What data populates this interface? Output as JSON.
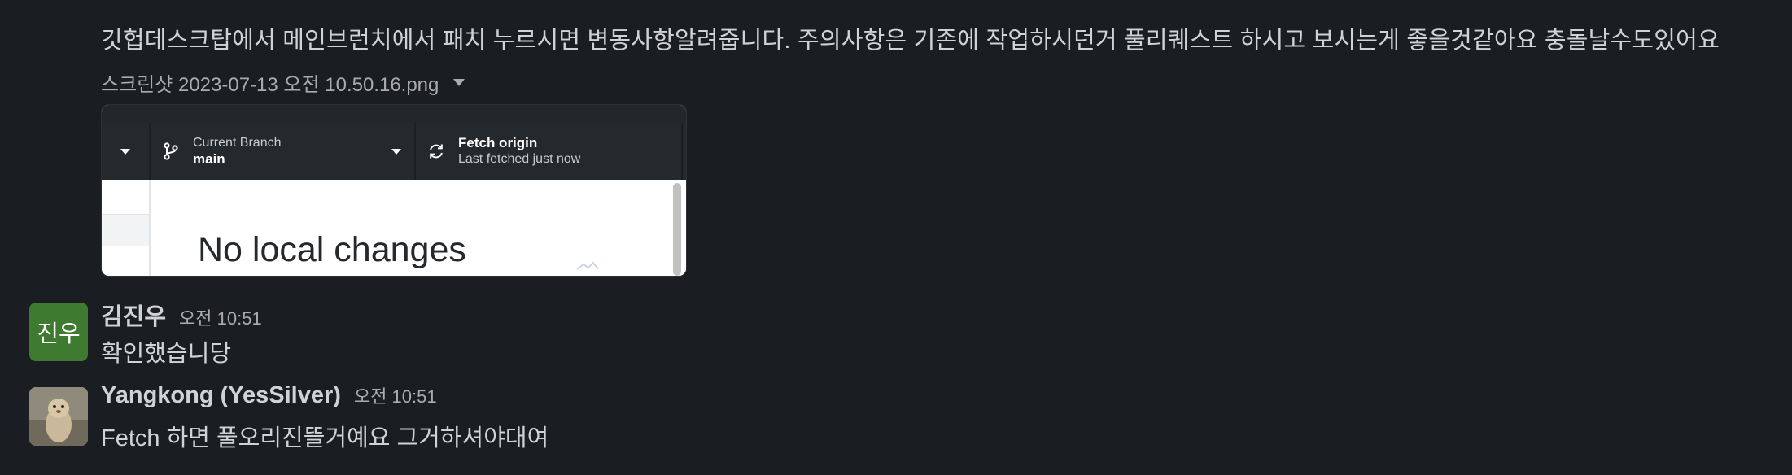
{
  "thread": {
    "prev_message": {
      "text": "깃헙데스크탑에서 메인브런치에서 패치 누르시면 변동사항알려줍니다. 주의사항은 기존에 작업하시던거 풀리퀘스트 하시고 보시는게 좋을것같아요 충돌날수도있어요",
      "file_name": "스크린샷 2023-07-13 오전 10.50.16.png",
      "attachment": {
        "current_branch_label": "Current Branch",
        "current_branch_value": "main",
        "fetch_label": "Fetch origin",
        "fetch_sub": "Last fetched just now",
        "empty_state": "No local changes"
      }
    },
    "messages": [
      {
        "author": "김진우",
        "avatar_text": "진우",
        "avatar_color": "#3e7a2f",
        "time": "오전 10:51",
        "text": "확인했습니당"
      },
      {
        "author": "Yangkong (YesSilver)",
        "time": "오전 10:51",
        "text": "Fetch 하면 풀오리진뜰거예요 그거하셔야대여"
      }
    ]
  },
  "colors": {
    "background": "#1a1d21",
    "text": "#d1d2d3",
    "muted": "#ababad"
  }
}
